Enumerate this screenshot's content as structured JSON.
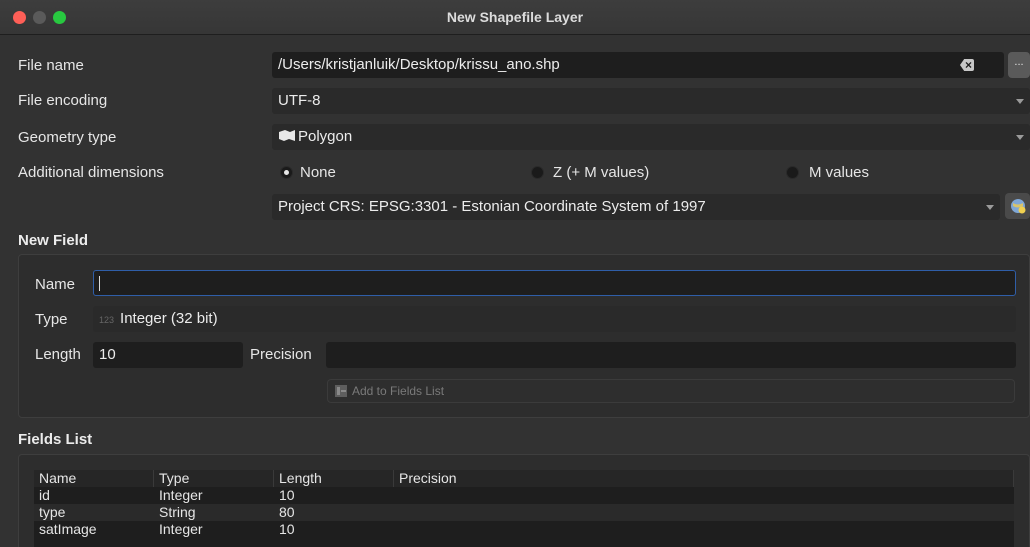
{
  "window": {
    "title": "New Shapefile Layer"
  },
  "form": {
    "file_name_label": "File name",
    "file_name_value": "/Users/kristjanluik/Desktop/krissu_ano.shp",
    "browse_label": "...",
    "file_encoding_label": "File encoding",
    "file_encoding_value": "UTF-8",
    "geometry_type_label": "Geometry type",
    "geometry_type_value": "Polygon",
    "additional_dimensions_label": "Additional dimensions",
    "dimensions": [
      {
        "label": "None",
        "checked": true
      },
      {
        "label": "Z (+ M values)",
        "checked": false
      },
      {
        "label": "M values",
        "checked": false
      }
    ],
    "crs_value": "Project CRS: EPSG:3301 - Estonian Coordinate System of 1997"
  },
  "new_field": {
    "title": "New Field",
    "name_label": "Name",
    "name_value": "",
    "type_label": "Type",
    "type_icon_text": "123",
    "type_value": "Integer (32 bit)",
    "length_label": "Length",
    "length_value": "10",
    "precision_label": "Precision",
    "precision_value": "",
    "add_button_label": "Add to Fields List"
  },
  "fields_list": {
    "title": "Fields List",
    "columns": [
      "Name",
      "Type",
      "Length",
      "Precision"
    ],
    "rows": [
      [
        "id",
        "Integer",
        "10",
        ""
      ],
      [
        "type",
        "String",
        "80",
        ""
      ],
      [
        "satImage",
        "Integer",
        "10",
        ""
      ]
    ]
  },
  "colors": {
    "background": "#323232",
    "input_background": "#1e1e1e",
    "focus_border": "#2f5ea8",
    "close": "#fe5f57",
    "maximize": "#28c840"
  }
}
